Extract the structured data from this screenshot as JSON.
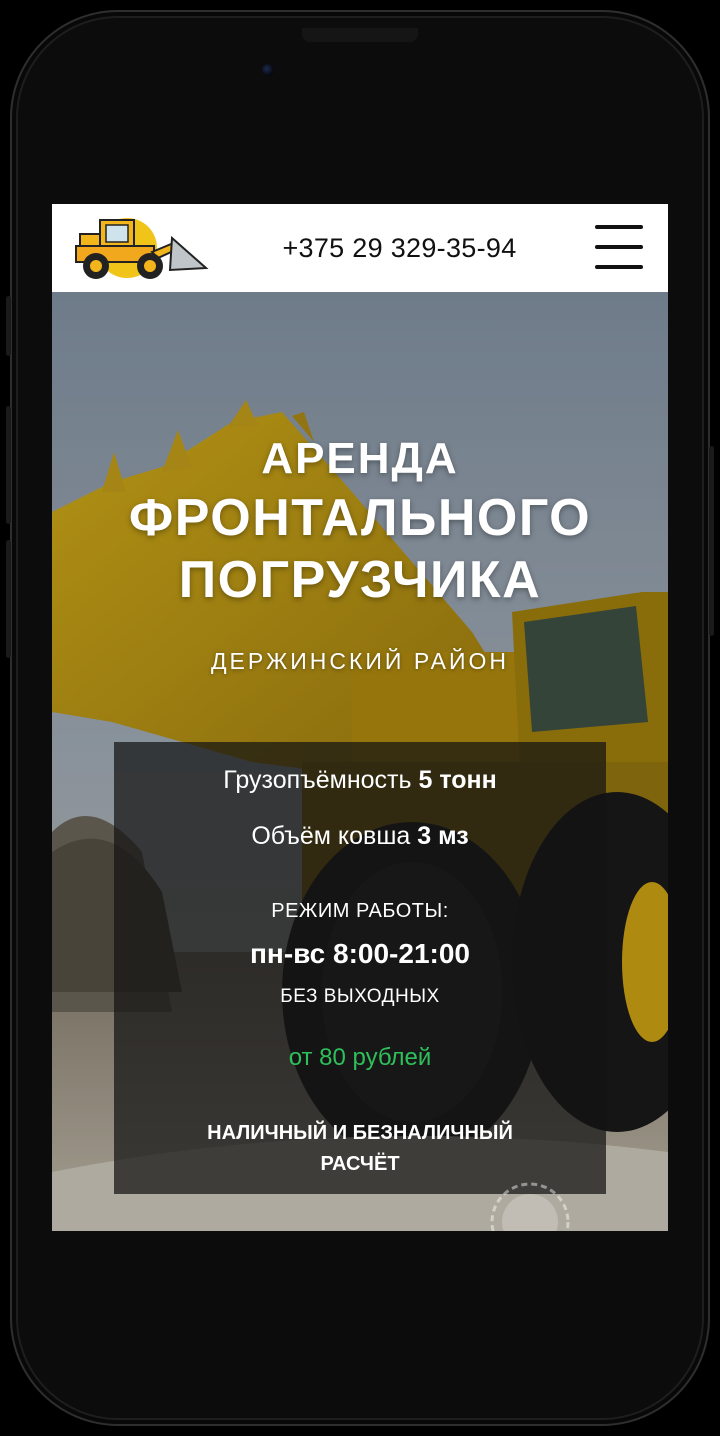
{
  "header": {
    "phone": "+375 29 329-35-94",
    "menu_icon": "hamburger-menu-icon",
    "logo_icon": "front-loader-logo-icon"
  },
  "hero": {
    "title_line1": "АРЕНДА",
    "title_line2": "ФРОНТАЛЬНОГО",
    "title_line3": "ПОГРУЗЧИКА",
    "district": "ДЕРЖИНСКИЙ РАЙОН"
  },
  "info": {
    "capacity_label": "Грузопъёмность",
    "capacity_value": "5 тонн",
    "bucket_label": "Объём ковша",
    "bucket_value": "3 мз",
    "schedule_label": "РЕЖИМ РАБОТЫ:",
    "schedule_value": "пн-вс 8:00-21:00",
    "days_off": "БЕЗ ВЫХОДНЫХ",
    "price": "от 80 рублей",
    "payment_line1": "НАЛИЧНЫЙ И БЕЗНАЛИЧНЫЙ",
    "payment_line2": "РАСЧЁТ"
  },
  "colors": {
    "accent_yellow": "#e8c11c",
    "price_green": "#2fbf5a",
    "overlay": "#141414"
  }
}
